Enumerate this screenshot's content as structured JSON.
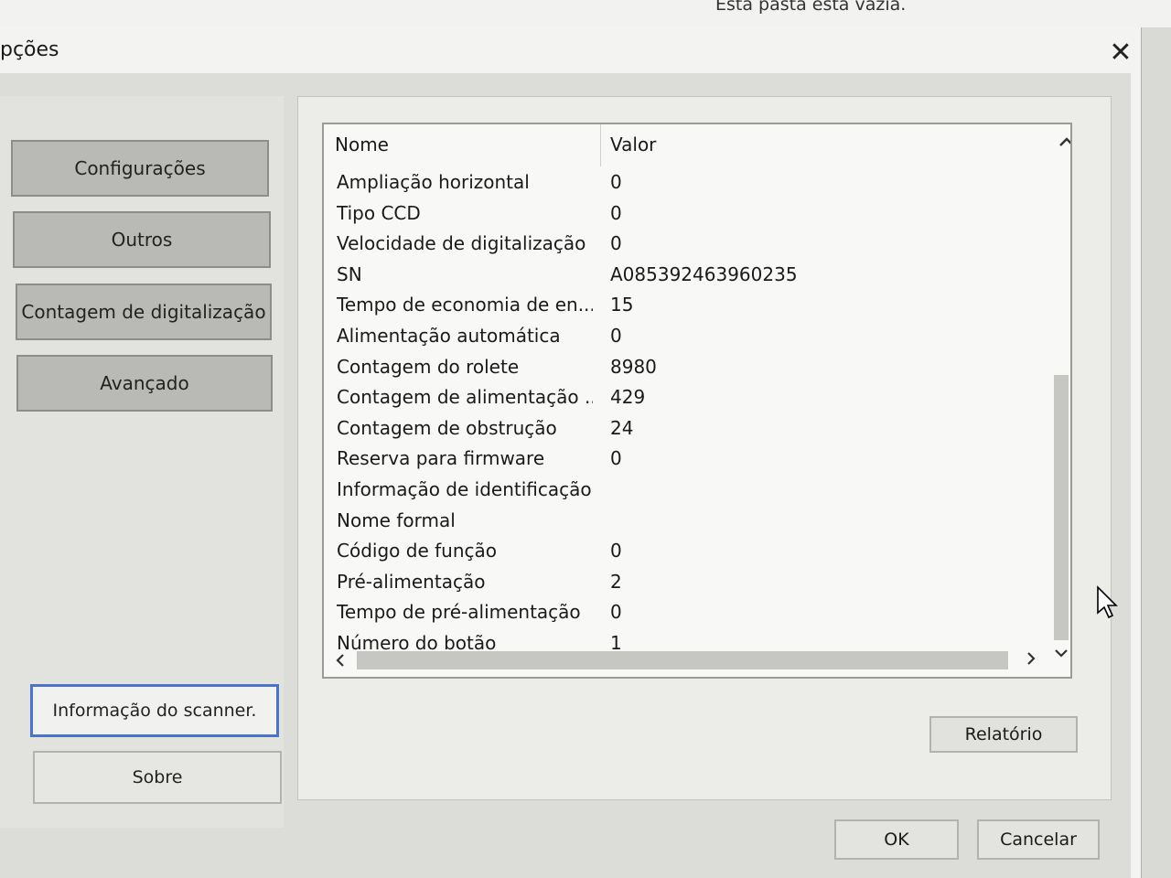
{
  "background": {
    "folder_status": "Esta pasta está vazia."
  },
  "dialog": {
    "title": "pções",
    "close_glyph": "✕",
    "nav_buttons": [
      {
        "label": "Configurações"
      },
      {
        "label": "Outros"
      },
      {
        "label": "Contagem de digitalização"
      },
      {
        "label": "Avançado"
      }
    ],
    "scanner_info_button": "Informação do scanner.",
    "about_button": "Sobre",
    "list": {
      "headers": {
        "name": "Nome",
        "value": "Valor"
      },
      "rows": [
        {
          "name": "Ampliação horizontal",
          "value": "0"
        },
        {
          "name": "Tipo CCD",
          "value": "0"
        },
        {
          "name": "Velocidade de digitalização",
          "value": "0"
        },
        {
          "name": "SN",
          "value": "A085392463960235"
        },
        {
          "name": "Tempo de economia de en...",
          "value": "15"
        },
        {
          "name": "Alimentação automática",
          "value": "0"
        },
        {
          "name": "Contagem do rolete",
          "value": "8980"
        },
        {
          "name": "Contagem de alimentação ...",
          "value": "429"
        },
        {
          "name": "Contagem de obstrução",
          "value": "24"
        },
        {
          "name": "Reserva para firmware",
          "value": "0"
        },
        {
          "name": "Informação de identificação",
          "value": ""
        },
        {
          "name": "Nome formal",
          "value": ""
        },
        {
          "name": "Código de função",
          "value": "0"
        },
        {
          "name": "Pré-alimentação",
          "value": "2"
        },
        {
          "name": "Tempo de pré-alimentação",
          "value": "0"
        },
        {
          "name": "Número do botão",
          "value": "1"
        }
      ]
    },
    "report_button": "Relatório",
    "ok_button": "OK",
    "cancel_button": "Cancelar"
  },
  "icons": {
    "close": "close-icon",
    "scroll_up": "chevron-up-icon",
    "scroll_down": "chevron-down-icon",
    "scroll_left": "chevron-left-icon",
    "scroll_right": "chevron-right-icon",
    "cursor": "mouse-pointer-icon"
  },
  "colors": {
    "focus": "#4a73c9",
    "nav_button": "#b9b9b6"
  }
}
